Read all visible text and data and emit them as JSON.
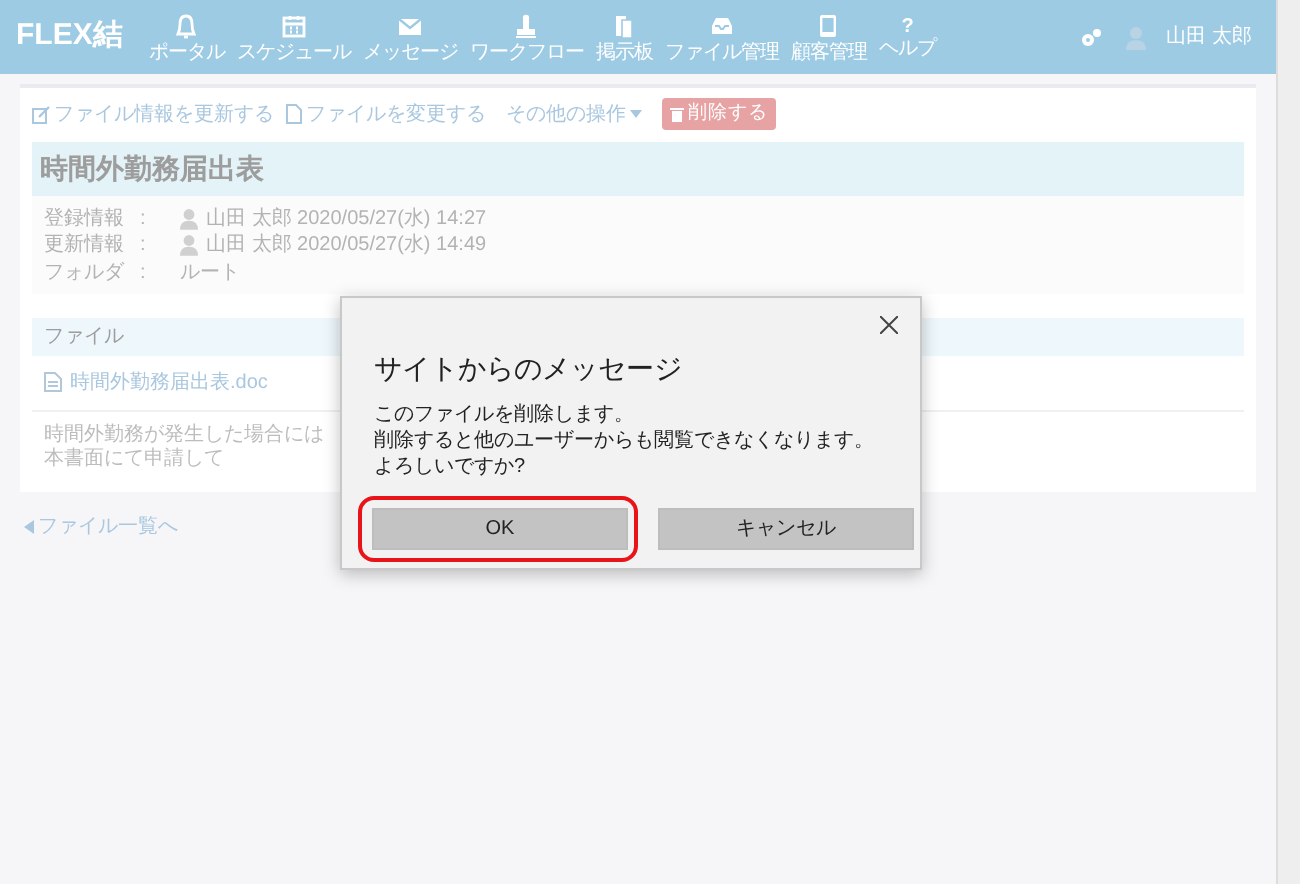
{
  "app": {
    "logo": "FLEX結"
  },
  "nav": [
    {
      "label": "ポータル"
    },
    {
      "label": "スケジュール"
    },
    {
      "label": "メッセージ"
    },
    {
      "label": "ワークフロー"
    },
    {
      "label": "掲示板"
    },
    {
      "label": "ファイル管理"
    },
    {
      "label": "顧客管理"
    },
    {
      "label": "ヘルプ",
      "icon_char": "?"
    }
  ],
  "user": {
    "name": "山田 太郎"
  },
  "toolbar": [
    {
      "kind": "link",
      "label": "ファイル情報を更新する"
    },
    {
      "kind": "link",
      "label": "ファイルを変更する"
    },
    {
      "kind": "dropdown",
      "label": "その他の操作"
    },
    {
      "kind": "danger",
      "label": "削除する"
    }
  ],
  "document": {
    "title": "時間外勤務届出表",
    "fields": [
      {
        "label": "登録情報",
        "separator": ":",
        "value": "山田 太郎 2020/05/27(水) 14:27",
        "avatar": true
      },
      {
        "label": "更新情報",
        "separator": ":",
        "value": "山田 太郎 2020/05/27(水) 14:49",
        "avatar": true
      },
      {
        "label": "フォルダ",
        "separator": ":",
        "value": "ルート",
        "avatar": false
      }
    ],
    "file_section": {
      "heading": "ファイル",
      "file_name": "時間外勤務届出表.doc",
      "note": "時間外勤務が発生した場合には本書面にて申請して"
    }
  },
  "back_link": "ファイル一覧へ",
  "dialog": {
    "title": "サイトからのメッセージ",
    "message": [
      "このファイルを削除します。",
      "削除すると他のユーザーからも閲覧できなくなります。",
      "よろしいですか?"
    ],
    "buttons": [
      {
        "label": "OK",
        "highlighted": true
      },
      {
        "label": "キャンセル",
        "highlighted": false
      }
    ]
  }
}
